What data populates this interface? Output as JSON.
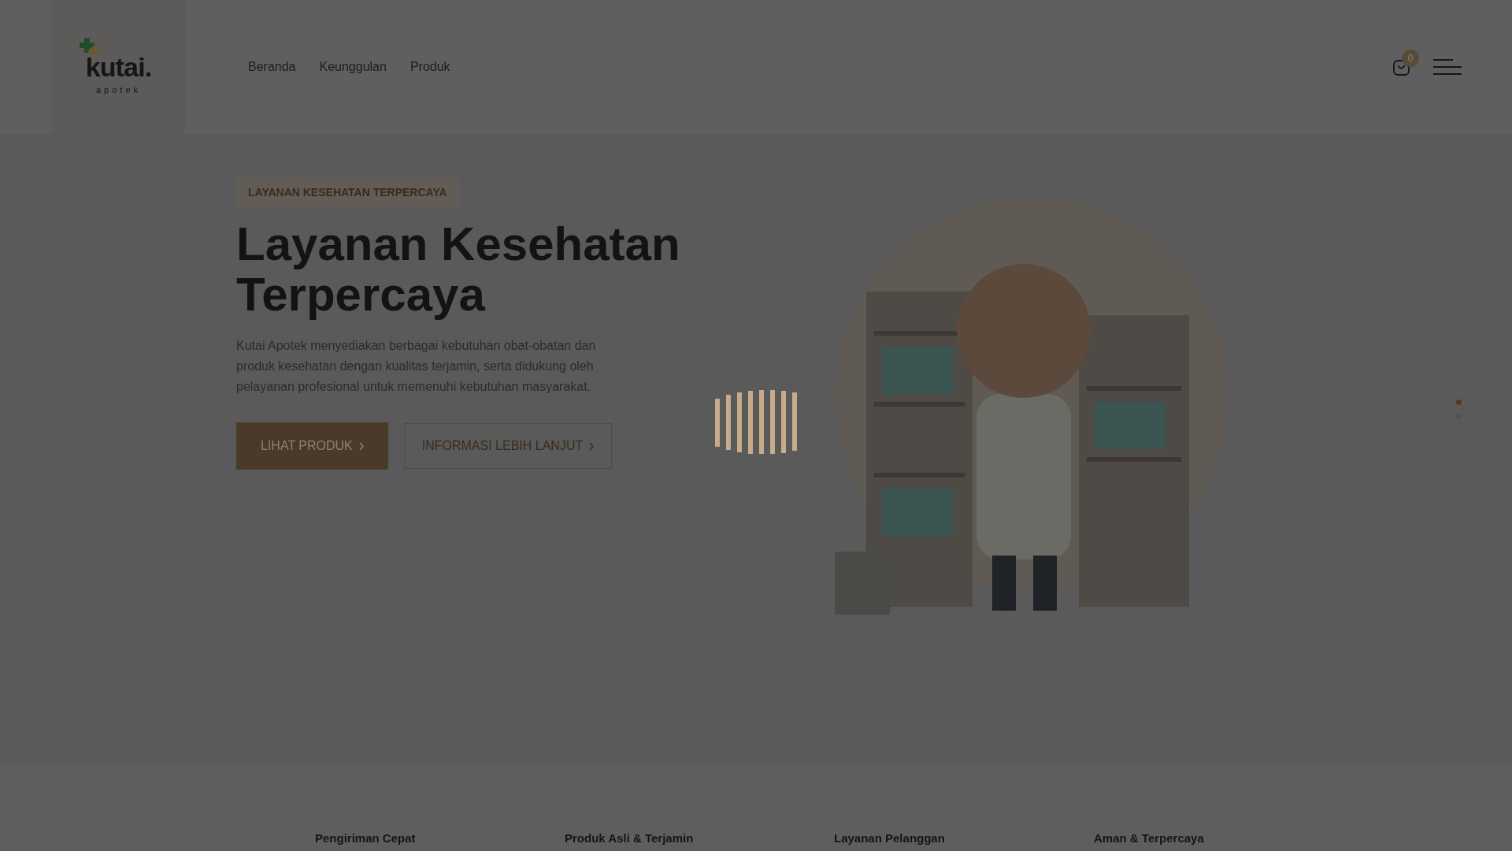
{
  "header": {
    "logo": {
      "wordmark": "kutai.",
      "tagline": "apotek"
    },
    "nav": [
      {
        "label": "Beranda"
      },
      {
        "label": "Keunggulan"
      },
      {
        "label": "Produk"
      }
    ],
    "cart_count": "0"
  },
  "hero": {
    "badge": "LAYANAN KESEHATAN TERPERCAYA",
    "title_lines": [
      "Layanan Kesehatan",
      "Terpercaya"
    ],
    "description": "Kutai Apotek menyediakan berbagai kebutuhan obat-obatan dan produk kesehatan dengan kualitas terjamin, serta didukung oleh pelayanan profesional untuk memenuhi kebutuhan masyarakat.",
    "buttons": [
      {
        "label": "LIHAT PRODUK",
        "kind": "filled"
      },
      {
        "label": "INFORMASI LEBIH LANJUT",
        "kind": "outline"
      }
    ],
    "illustration": {
      "kind": "picture"
    },
    "slides": [
      {
        "selected": true
      },
      {
        "selected": false
      }
    ]
  },
  "features": [
    {
      "title": "Pengiriman Cepat"
    },
    {
      "title": "Produk Asli & Terjamin"
    },
    {
      "title": "Layanan Pelanggan"
    },
    {
      "title": "Aman & Terpercaya"
    }
  ]
}
